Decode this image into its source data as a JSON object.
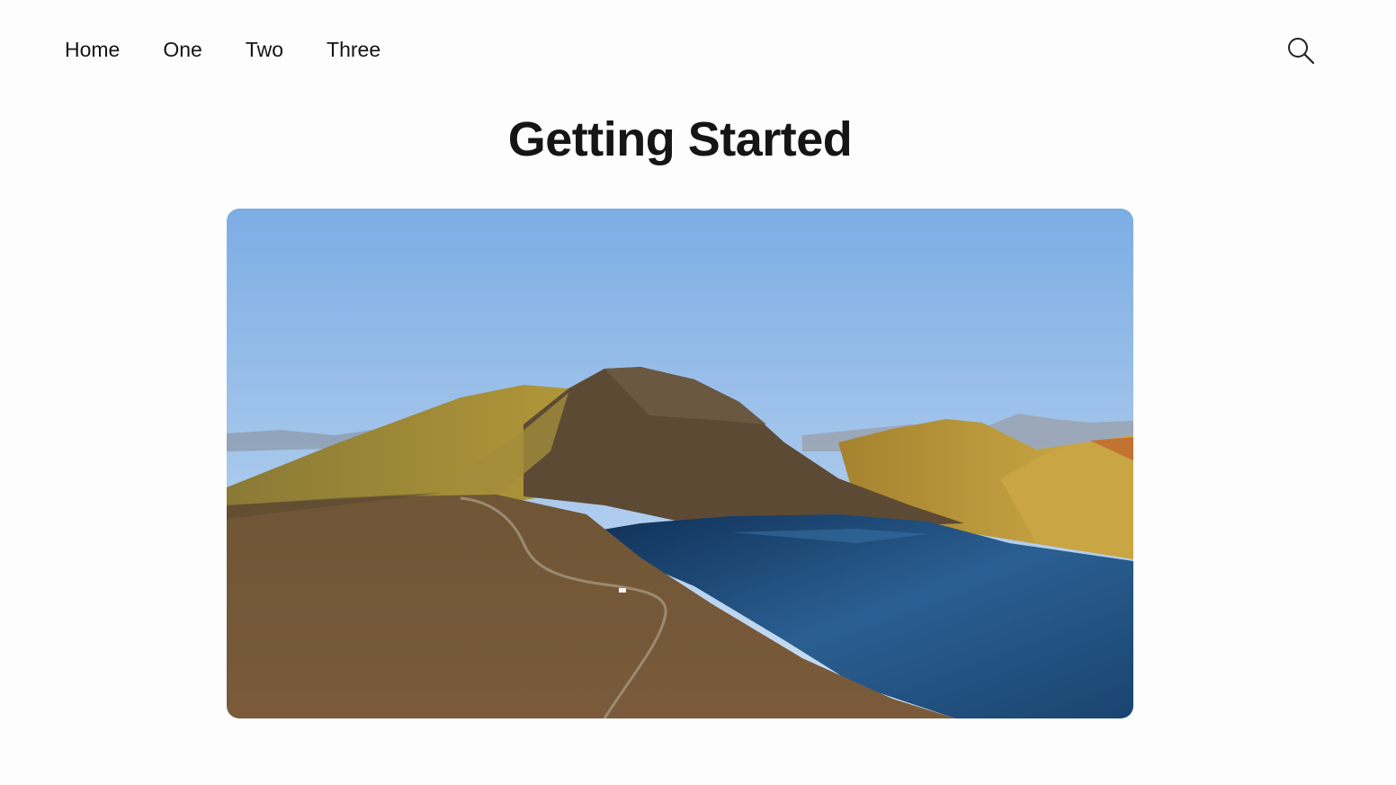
{
  "nav": {
    "items": [
      {
        "label": "Home"
      },
      {
        "label": "One"
      },
      {
        "label": "Two"
      },
      {
        "label": "Three"
      }
    ],
    "search_icon": "search-icon"
  },
  "page": {
    "title": "Getting Started"
  },
  "featured_image": {
    "subject": "aerial-landscape-mountain-lake",
    "colors": {
      "sky_top": "#7fb0e6",
      "sky_bottom": "#c8dcf2",
      "mountain_dark": "#5a4630",
      "mountain_lit": "#b39a3c",
      "lake": "#1e4f80",
      "ground": "#7a5e3e"
    }
  }
}
